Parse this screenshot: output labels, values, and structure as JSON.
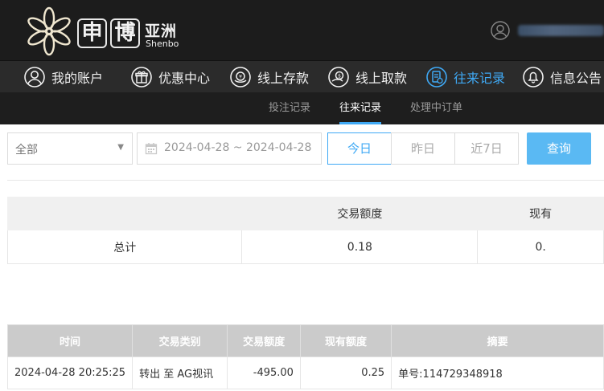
{
  "brand": {
    "box1": "申",
    "box2": "博",
    "cn": "亚洲",
    "en": "Shenbo"
  },
  "nav": {
    "items": [
      {
        "label": "我的账户",
        "icon": "user-icon"
      },
      {
        "label": "优惠中心",
        "icon": "gift-icon"
      },
      {
        "label": "线上存款",
        "icon": "deposit-icon"
      },
      {
        "label": "线上取款",
        "icon": "withdraw-icon"
      },
      {
        "label": "往来记录",
        "icon": "record-icon",
        "active": true
      },
      {
        "label": "信息公告",
        "icon": "bell-icon"
      }
    ]
  },
  "subnav": {
    "items": [
      {
        "label": "投注记录"
      },
      {
        "label": "往来记录",
        "active": true
      },
      {
        "label": "处理中订单"
      }
    ]
  },
  "filter": {
    "type_select": "全部",
    "date_range": "2024-04-28 ~ 2024-04-28",
    "quick": [
      "今日",
      "昨日",
      "近7日"
    ],
    "search_label": "查询"
  },
  "summary": {
    "headers": [
      "",
      "交易额度",
      "现有"
    ],
    "row": {
      "label": "总计",
      "amount": "0.18",
      "balance": "0."
    }
  },
  "records": {
    "headers": [
      "时间",
      "交易类别",
      "交易额度",
      "现有额度",
      "摘要"
    ],
    "rows": [
      {
        "time": "2024-04-28 20:25:25",
        "type": "转出 至 AG视讯",
        "amount": "-495.00",
        "balance": "0.25",
        "summary": "单号:114729348918"
      }
    ]
  },
  "colors": {
    "accent": "#3fa9f5",
    "header_bg": "#1c1c1c",
    "nav_bg": "#2b2b2b",
    "search_button": "#5ab9f3"
  }
}
